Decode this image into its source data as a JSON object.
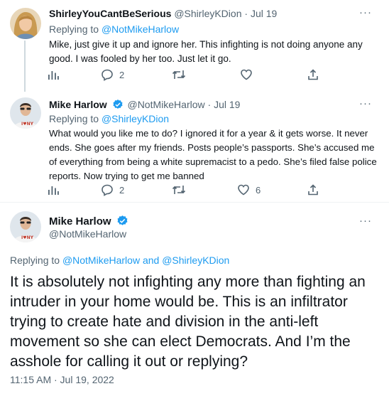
{
  "tweets": [
    {
      "display_name": "ShirleyYouCantBeSerious",
      "handle": "@ShirleyKDion",
      "separator": "·",
      "date": "Jul 19",
      "replying_prefix": "Replying to",
      "replying_to": "@NotMikeHarlow",
      "text": "Mike, just give it up and ignore her. This infighting is not doing anyone any good. I was fooled by her too. Just let it go.",
      "replies": "2",
      "retweets": "",
      "likes": ""
    },
    {
      "display_name": "Mike Harlow",
      "handle": "@NotMikeHarlow",
      "separator": "·",
      "date": "Jul 19",
      "replying_prefix": "Replying to",
      "replying_to": "@ShirleyKDion",
      "text": "What would you like me to do? I ignored it for a year & it gets worse. It never ends. She goes after my friends. Posts people’s passports. She’s accused me of everything from being a white supremacist to a pedo. She’s filed false police reports. Now trying to get me banned",
      "replies": "2",
      "retweets": "",
      "likes": "6"
    }
  ],
  "main_tweet": {
    "display_name": "Mike Harlow",
    "handle": "@NotMikeHarlow",
    "replying_prefix": "Replying to",
    "replying_to": "@NotMikeHarlow and @ShirleyKDion",
    "text": "It is absolutely not infighting any more than fighting an intruder in your home would be. This is an infiltrator trying to create hate and division in the anti-left movement so she can elect Democrats. And I’m the asshole for calling it out or replying?",
    "timestamp": "11:15 AM · Jul 19, 2022"
  },
  "more_label": "···",
  "avatar_shirt_text": "I ♥ NY",
  "icons": [
    "analytics-icon",
    "reply-icon",
    "retweet-icon",
    "like-icon",
    "share-icon",
    "verified-badge-icon",
    "more-icon"
  ],
  "colors": {
    "text": "#0f1419",
    "secondary": "#536471",
    "accent": "#1d9bf0",
    "divider": "#eff3f4"
  }
}
